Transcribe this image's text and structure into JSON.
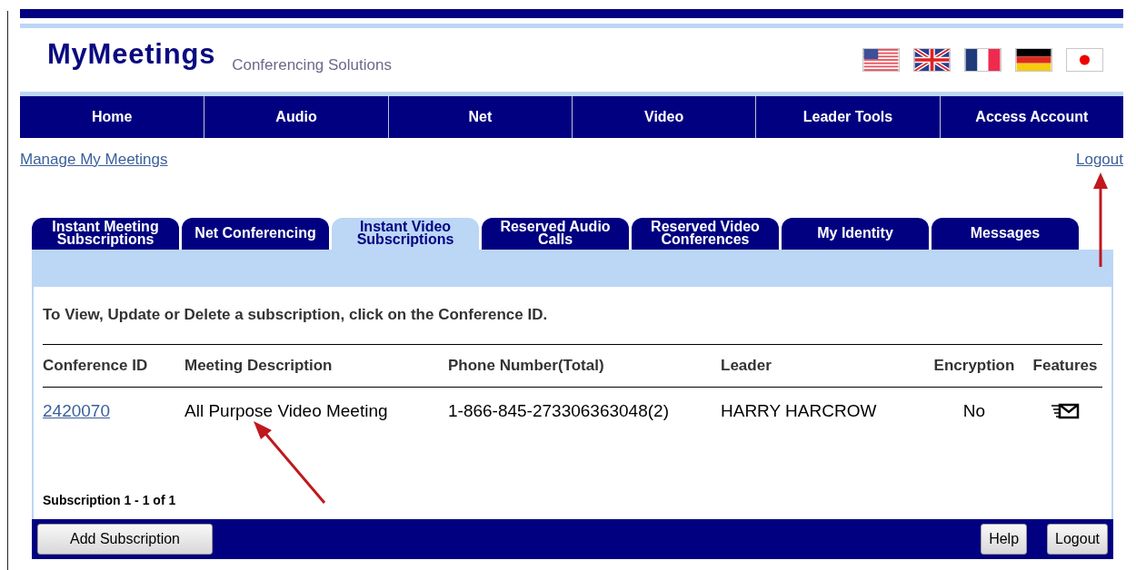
{
  "header": {
    "logo": "MyMeetings",
    "tagline": "Conferencing Solutions",
    "flags": [
      {
        "kind": "us"
      },
      {
        "kind": "uk"
      },
      {
        "kind": "fr"
      },
      {
        "kind": "de"
      },
      {
        "kind": "jp"
      }
    ]
  },
  "nav": [
    "Home",
    "Audio",
    "Net",
    "Video",
    "Leader Tools",
    "Access Account"
  ],
  "links": {
    "left": "Manage My Meetings",
    "right": "Logout"
  },
  "tabs": [
    {
      "label": "Instant Meeting Subscriptions",
      "selected": false
    },
    {
      "label": "Net Conferencing",
      "selected": false
    },
    {
      "label": "Instant Video Subscriptions",
      "selected": true
    },
    {
      "label": "Reserved Audio Calls",
      "selected": false
    },
    {
      "label": "Reserved Video Conferences",
      "selected": false
    },
    {
      "label": "My Identity",
      "selected": false
    },
    {
      "label": "Messages",
      "selected": false
    }
  ],
  "instruction": "To View, Update or Delete a subscription, click on the Conference ID.",
  "table": {
    "columns": [
      "Conference ID",
      "Meeting Description",
      "Phone Number(Total)",
      "Leader",
      "Encryption",
      "Features"
    ],
    "rows": [
      {
        "id": "2420070",
        "description": "All Purpose Video Meeting",
        "phone": "1-866-845-273306363048(2)",
        "leader": "HARRY HARCROW",
        "encryption": "No",
        "features": [
          {
            "kind": "mail"
          }
        ]
      }
    ]
  },
  "count": "Subscription 1 - 1 of 1",
  "footer": {
    "left": "Add Subscription",
    "right": [
      "Help",
      "Logout"
    ]
  }
}
